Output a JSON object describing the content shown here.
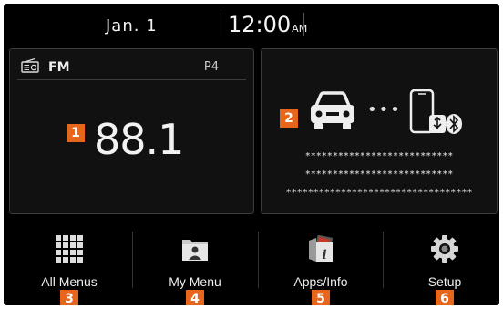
{
  "status": {
    "date": "Jan. 1",
    "time": "12:00",
    "ampm": "AM"
  },
  "radio": {
    "band": "FM",
    "preset": "P4",
    "frequency": "88.1",
    "badge": "1",
    "icon": "radio-icon"
  },
  "phone": {
    "badge": "2",
    "icons": [
      "car-icon",
      "phone-usb-bluetooth-icon"
    ],
    "dots": "•••",
    "lines": [
      "***************************",
      "***************************",
      "**********************************"
    ]
  },
  "menu": [
    {
      "label": "All Menus",
      "badge": "3",
      "icon": "grid-icon"
    },
    {
      "label": "My Menu",
      "badge": "4",
      "icon": "my-menu-icon"
    },
    {
      "label": "Apps/Info",
      "badge": "5",
      "icon": "info-icon"
    },
    {
      "label": "Setup",
      "badge": "6",
      "icon": "gear-icon"
    }
  ],
  "colors": {
    "accent": "#e8661c",
    "background": "#000000",
    "panel": "#111111"
  }
}
